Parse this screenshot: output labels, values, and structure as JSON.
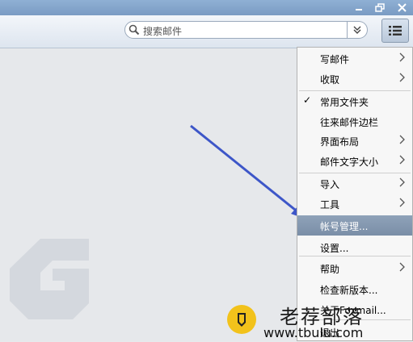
{
  "window": {
    "controls": [
      "minimize",
      "restore",
      "close"
    ]
  },
  "toolbar": {
    "search_placeholder": "搜索邮件",
    "search_icon": "search-icon",
    "dropdown_icon": "double-chevron-down-icon",
    "menu_icon": "list-menu-icon"
  },
  "menu": {
    "items": [
      {
        "label": "写邮件",
        "submenu": true
      },
      {
        "label": "收取",
        "submenu": true
      },
      {
        "label": "常用文件夹",
        "checked": true
      },
      {
        "label": "往来邮件边栏"
      },
      {
        "label": "界面布局",
        "submenu": true
      },
      {
        "label": "邮件文字大小",
        "submenu": true
      },
      {
        "label": "导入",
        "submenu": true
      },
      {
        "label": "工具",
        "submenu": true
      },
      {
        "label": "帐号管理...",
        "highlighted": true
      },
      {
        "label": "设置..."
      },
      {
        "label": "帮助",
        "submenu": true
      },
      {
        "label": "检查新版本..."
      },
      {
        "label": "关于Foxmail..."
      },
      {
        "label": "退出"
      }
    ]
  },
  "watermark": {
    "title": "老荐部落",
    "url": "www.tbulu.com"
  },
  "colors": {
    "highlight": "#7f93ab",
    "arrow": "#3d56c8",
    "titlebar": "#86a6cc"
  }
}
